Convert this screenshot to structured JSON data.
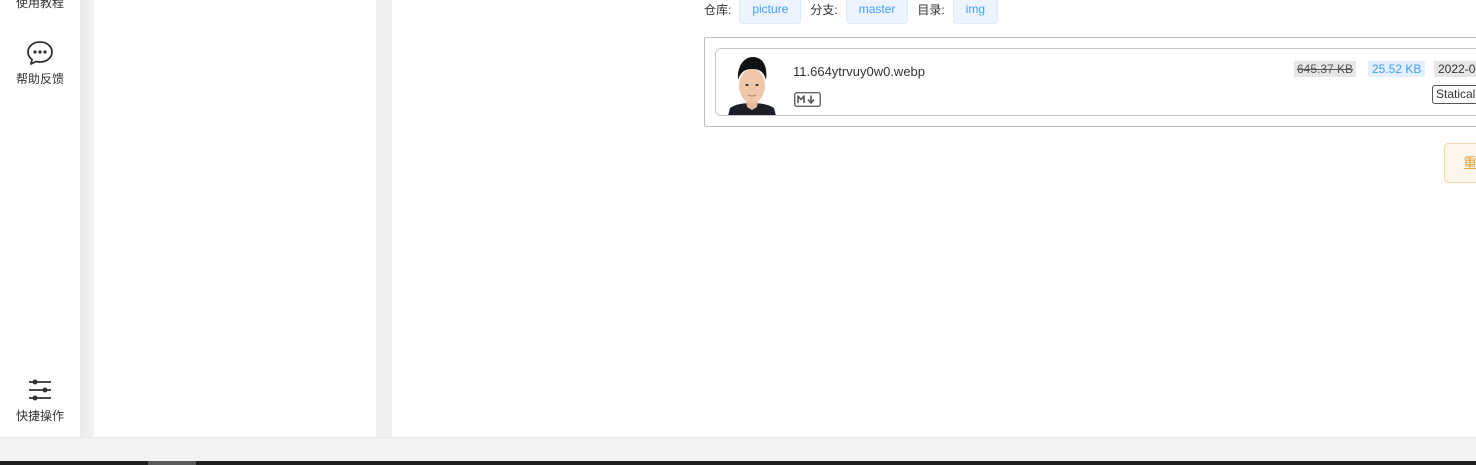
{
  "nav": {
    "top_label": "使用教程",
    "help_label": "帮助反馈",
    "quick_label": "快捷操作"
  },
  "info": {
    "repo_label": "仓库:",
    "repo_value": "picture",
    "branch_label": "分支:",
    "branch_value": "master",
    "dir_label": "目录:",
    "dir_value": "img"
  },
  "file": {
    "name": "11.664ytrvuy0w0.webp",
    "md_icon": "M↓",
    "original_size": "645.37 KB",
    "compressed_size": "25.52 KB",
    "date": "2022-0",
    "badge": "Statical"
  },
  "actions": {
    "reset_label": "重"
  },
  "colors": {
    "accent": "#409eff",
    "warning": "#e6a23c"
  }
}
